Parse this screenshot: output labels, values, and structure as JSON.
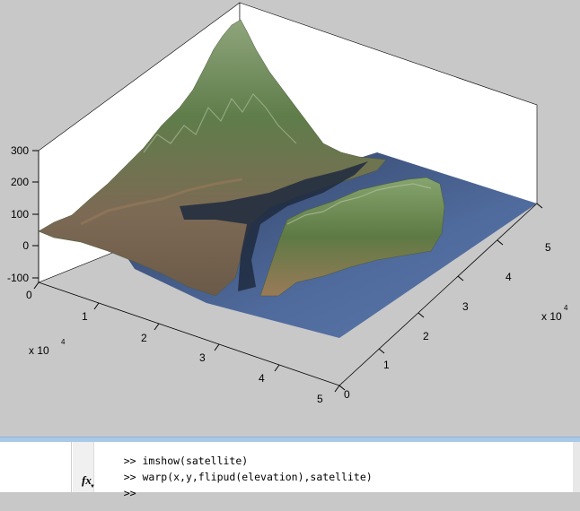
{
  "axes": {
    "z_ticks": [
      "300",
      "200",
      "100",
      "0",
      "-100"
    ],
    "x_ticks": [
      "0",
      "1",
      "2",
      "3",
      "4",
      "5"
    ],
    "y_ticks": [
      "0",
      "1",
      "2",
      "3",
      "4",
      "5"
    ],
    "x_multiplier": "x 10",
    "x_exponent": "4",
    "y_multiplier": "x 10",
    "y_exponent": "4"
  },
  "command_window": {
    "lines": [
      {
        "prompt": ">>",
        "text": "imshow(satellite)"
      },
      {
        "prompt": ">>",
        "text": "warp(x,y,flipud(elevation),satellite)"
      },
      {
        "prompt": ">>",
        "text": ""
      }
    ],
    "fx_label": "fx"
  },
  "colors": {
    "figure_bg": "#c8c8c8",
    "water": "#4f6a9c",
    "terrain_green": "#5f7d4a",
    "terrain_brown": "#8a6a4e",
    "divider": "#a9c9e8"
  }
}
